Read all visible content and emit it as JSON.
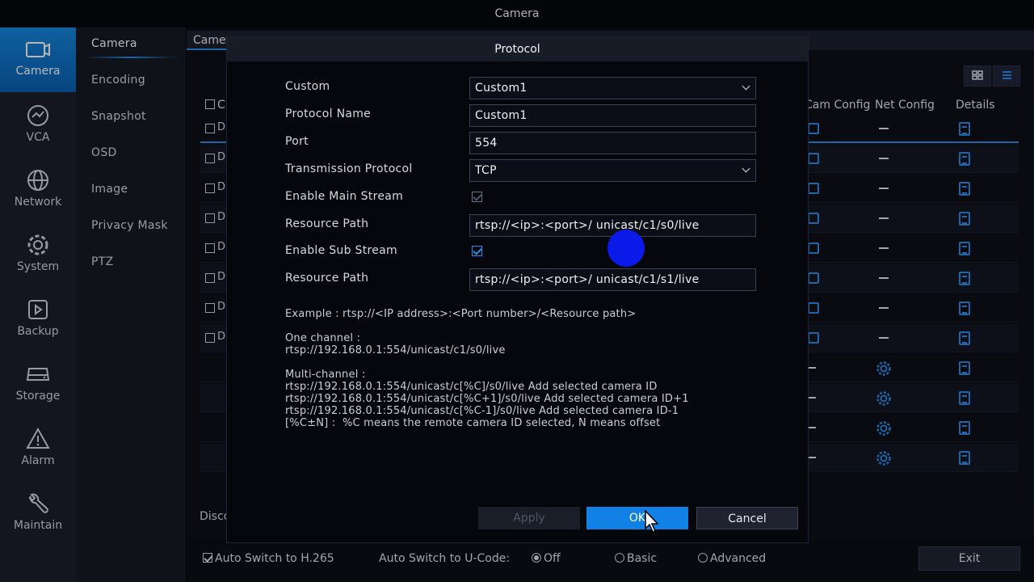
{
  "window_title": "Camera",
  "rail": [
    {
      "label": "Camera",
      "icon": "camera-icon",
      "active": true
    },
    {
      "label": "VCA",
      "icon": "vca-icon"
    },
    {
      "label": "Network",
      "icon": "globe-icon"
    },
    {
      "label": "System",
      "icon": "gear-icon"
    },
    {
      "label": "Backup",
      "icon": "backup-icon"
    },
    {
      "label": "Storage",
      "icon": "storage-icon"
    },
    {
      "label": "Alarm",
      "icon": "warning-icon"
    },
    {
      "label": "Maintain",
      "icon": "wrench-icon"
    }
  ],
  "submenu": [
    "Camera",
    "Encoding",
    "Snapshot",
    "OSD",
    "Image",
    "Privacy Mask",
    "PTZ"
  ],
  "main": {
    "tab_active": "Came",
    "table_headers": {
      "col1": "C",
      "cam_config": "Cam Config",
      "net_config": "Net Config",
      "details": "Details"
    },
    "row_prefix": "D",
    "disconnect_text": "Disco"
  },
  "bottom": {
    "auto_switch_h265": "Auto Switch to H.265",
    "auto_switch_ucode_label": "Auto Switch to U-Code:",
    "opt_off": "Off",
    "opt_basic": "Basic",
    "opt_advanced": "Advanced",
    "exit_label": "Exit"
  },
  "modal": {
    "title": "Protocol",
    "custom_label": "Custom",
    "custom_value": "Custom1",
    "protocol_name_label": "Protocol Name",
    "protocol_name_value": "Custom1",
    "port_label": "Port",
    "port_value": "554",
    "transmission_label": "Transmission Protocol",
    "transmission_value": "TCP",
    "enable_main_label": "Enable Main Stream",
    "resource_path_label": "Resource Path",
    "resource_path_main": "rtsp://<ip>:<port>/ unicast/c1/s0/live",
    "enable_sub_label": "Enable Sub Stream",
    "resource_path_label_2": "Resource Path",
    "resource_path_sub": "rtsp://<ip>:<port>/ unicast/c1/s1/live",
    "example": "Example : rtsp://<IP address>:<Port number>/<Resource path>",
    "one_channel": "One channel :\nrtsp://192.168.0.1:554/unicast/c1/s0/live",
    "multi_channel": "Multi-channel :\nrtsp://192.168.0.1:554/unicast/c[%C]/s0/live Add selected camera ID\nrtsp://192.168.0.1:554/unicast/c[%C+1]/s0/live Add selected camera ID+1\nrtsp://192.168.0.1:554/unicast/c[%C-1]/s0/live Add selected camera ID-1\n[%C±N] :  %C means the remote camera ID selected, N means offset",
    "apply_label": "Apply",
    "ok_label": "OK",
    "cancel_label": "Cancel"
  },
  "colors": {
    "accent": "#1181e6",
    "rail_active": "#1586dc",
    "touch_dot": "#0a1ae8"
  }
}
